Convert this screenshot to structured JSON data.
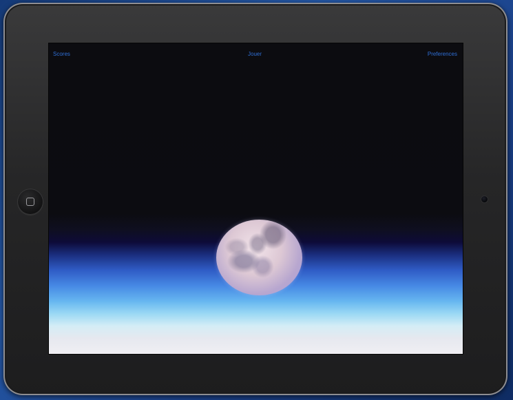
{
  "toolbar": {
    "scores_label": "Scores",
    "play_label": "Jouer",
    "preferences_label": "Preferences"
  },
  "colors": {
    "toolbar_text": "#2f6fd6",
    "screen_background": "#0c0c10",
    "device_bezel": "#262627"
  },
  "icons": {
    "home_button": "home-square-icon",
    "camera": "camera-icon"
  }
}
